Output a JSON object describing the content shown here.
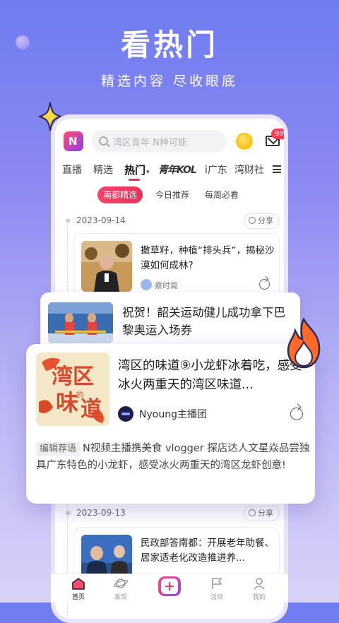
{
  "hero": {
    "title": "看热门",
    "subtitle": "精选内容 尽收眼底"
  },
  "topbar": {
    "search_placeholder": "湾区青年 N种可能",
    "mail_badge": "99+"
  },
  "tabs": [
    {
      "label": "直播"
    },
    {
      "label": "精选"
    },
    {
      "label": "热门",
      "active": true
    },
    {
      "label": "青年KOL"
    },
    {
      "label": "i广东"
    },
    {
      "label": "湾财社"
    }
  ],
  "subtabs": [
    {
      "label": "南都精选",
      "active": true
    },
    {
      "label": "今日推荐"
    },
    {
      "label": "每周必看"
    }
  ],
  "share_label": "分享",
  "groups": [
    {
      "date": "2023-09-14",
      "card": {
        "title": "撒草籽，种植“排头兵”，揭秘沙漠如何成林?",
        "source": "察时局"
      }
    },
    {
      "date": "2023-09-13",
      "card": {
        "title": "民政部答南都：开展老年助餐、居家适老化改造推进养..."
      }
    }
  ],
  "float_card_1": {
    "title": "祝贺！韶关运动健儿成功拿下巴黎奥运入场券"
  },
  "float_card_2": {
    "title": "湾区的味道⑨小龙虾冰着吃，感受冰火两重天的湾区味道...",
    "source": "Nyoung主播团",
    "editor_tag": "编辑荐语",
    "description": "N视频主播携美食 vlogger 探店达人文星焱品尝独具广东特色的小龙虾，感受冰火两重天的湾区龙虾创意!",
    "thumb_text": "湾区味的道"
  },
  "bottom_nav": [
    {
      "label": "首页",
      "active": true
    },
    {
      "label": "发现"
    },
    {
      "label": ""
    },
    {
      "label": "活动"
    },
    {
      "label": "我的"
    }
  ],
  "colors": {
    "accent": "#e5344a",
    "badge": "#ff3b4e",
    "background_top": "#6f7cf0",
    "background_bottom": "#d8d3f8"
  }
}
